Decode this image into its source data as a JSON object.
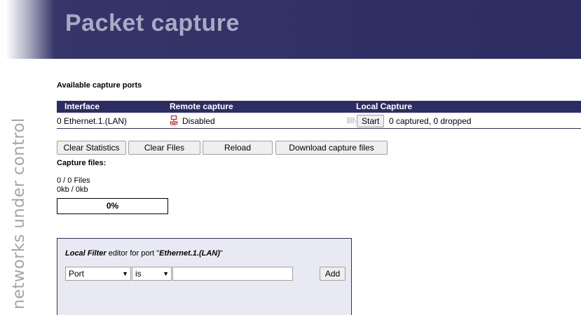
{
  "header": {
    "title": "Packet capture",
    "tagline": "networks under control"
  },
  "ports": {
    "section_label": "Available capture ports",
    "columns": [
      "Interface",
      "Remote capture",
      "Local Capture"
    ],
    "rows": [
      {
        "interface": "0 Ethernet.1.(LAN)",
        "remote_icon": "network-disabled-icon",
        "remote_status": "Disabled",
        "local_icon": "capture-status-icon",
        "start_label": "Start",
        "capture_status": "0 captured, 0 dropped"
      }
    ]
  },
  "actions": {
    "clear_statistics": "Clear Statistics",
    "clear_files": "Clear Files",
    "reload": "Reload",
    "download": "Download capture files"
  },
  "capture_files": {
    "label": "Capture files:",
    "files_count": "0 / 0 Files",
    "size": "0kb / 0kb",
    "progress_label": "0%",
    "progress_fraction": 0
  },
  "filter_editor": {
    "title_italic": "Local Filter",
    "title_middle": " editor for port \"",
    "title_port": "Ethernet.1.(LAN)",
    "title_end": "\"",
    "field_select": "Port",
    "operator_select": "is",
    "value_input": "",
    "add_label": "Add"
  },
  "colors": {
    "brand": "#2d2d63",
    "banner_title": "#a9a9c4",
    "tagline": "#a5a5a5",
    "panel_bg": "#e9e9f3",
    "alert_red": "#cc2222"
  }
}
